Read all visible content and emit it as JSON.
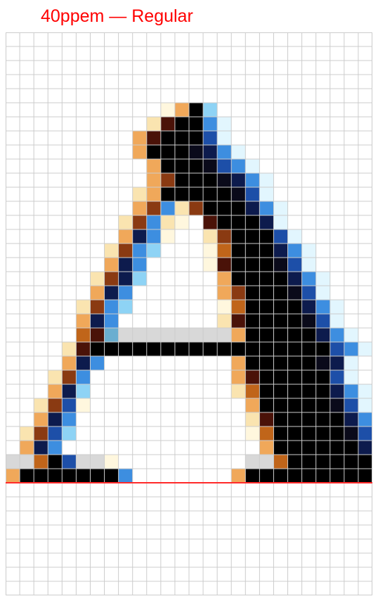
{
  "title": "40ppem — Regular",
  "glyph": "A",
  "colors": {
    "title": "#ff0000",
    "grid_line": "#cccccc",
    "baseline": "#ff2a2a",
    "palette": {
      "K": "#000000",
      "k": "#0a0a1a",
      "N": "#0d1b4d",
      "B": "#1d4fa8",
      "b": "#3d8ee0",
      "c": "#8ed3f5",
      "w": "#e2f6fe",
      "R": "#4a1208",
      "r": "#8a3a12",
      "O": "#c0651a",
      "o": "#f0a85a",
      "y": "#fae4b0",
      "e": "#fff7de",
      "t": "#2a3f48",
      "s": "#6aaed0",
      "g": "#d8d8d8"
    }
  },
  "grid": {
    "columns": 26,
    "rows": 40,
    "baseline_row": 31,
    "pixels": [
      "",
      "",
      "",
      "",
      "",
      "...........eoKc",
      "..........yRKKbw",
      ".........oRKKKBw",
      ".........oKKKkNbw",
      "..........oKKKkBbw",
      "..........orKKKkNbw",
      ".........yoKKKKKkBw",
      ".........orbyrKKKNbw",
      "........yrbye.RKKKNw",
      "........oNbe..yrKKKBw",
      ".......yrbc...eOKKKNbw",
      ".......oNb....eRKKKkBw",
      "......yrNc.....oKKKKNbw",
      "......oNb......orKKKkBw",
      ".....yrbc......eOKKKKNbw",
      ".....oNb.......yRKKKKkBw",
      ".....ORsggggggggoKKKKKNbw",
      "....yRKKKKKKKKKKKKKKKKKBbw",
      "....oNb.........oKKKKKkNw",
      "...yrb..........oRKKKKKBw",
      "...oNc..........yOKKKKKNbw",
      "..yrBe...........oKKKKKkBw",
      "..oNb............yRKKKKKNbw",
      ".yrBc............eOKKKKKkBw",
      ".oNb..............oKKKKKKNbw",
      "ggOKBgge.........ggOKKKKKKNcgw",
      "oKKKKKKKb.......oKKKKKKKKKKb"
    ]
  }
}
